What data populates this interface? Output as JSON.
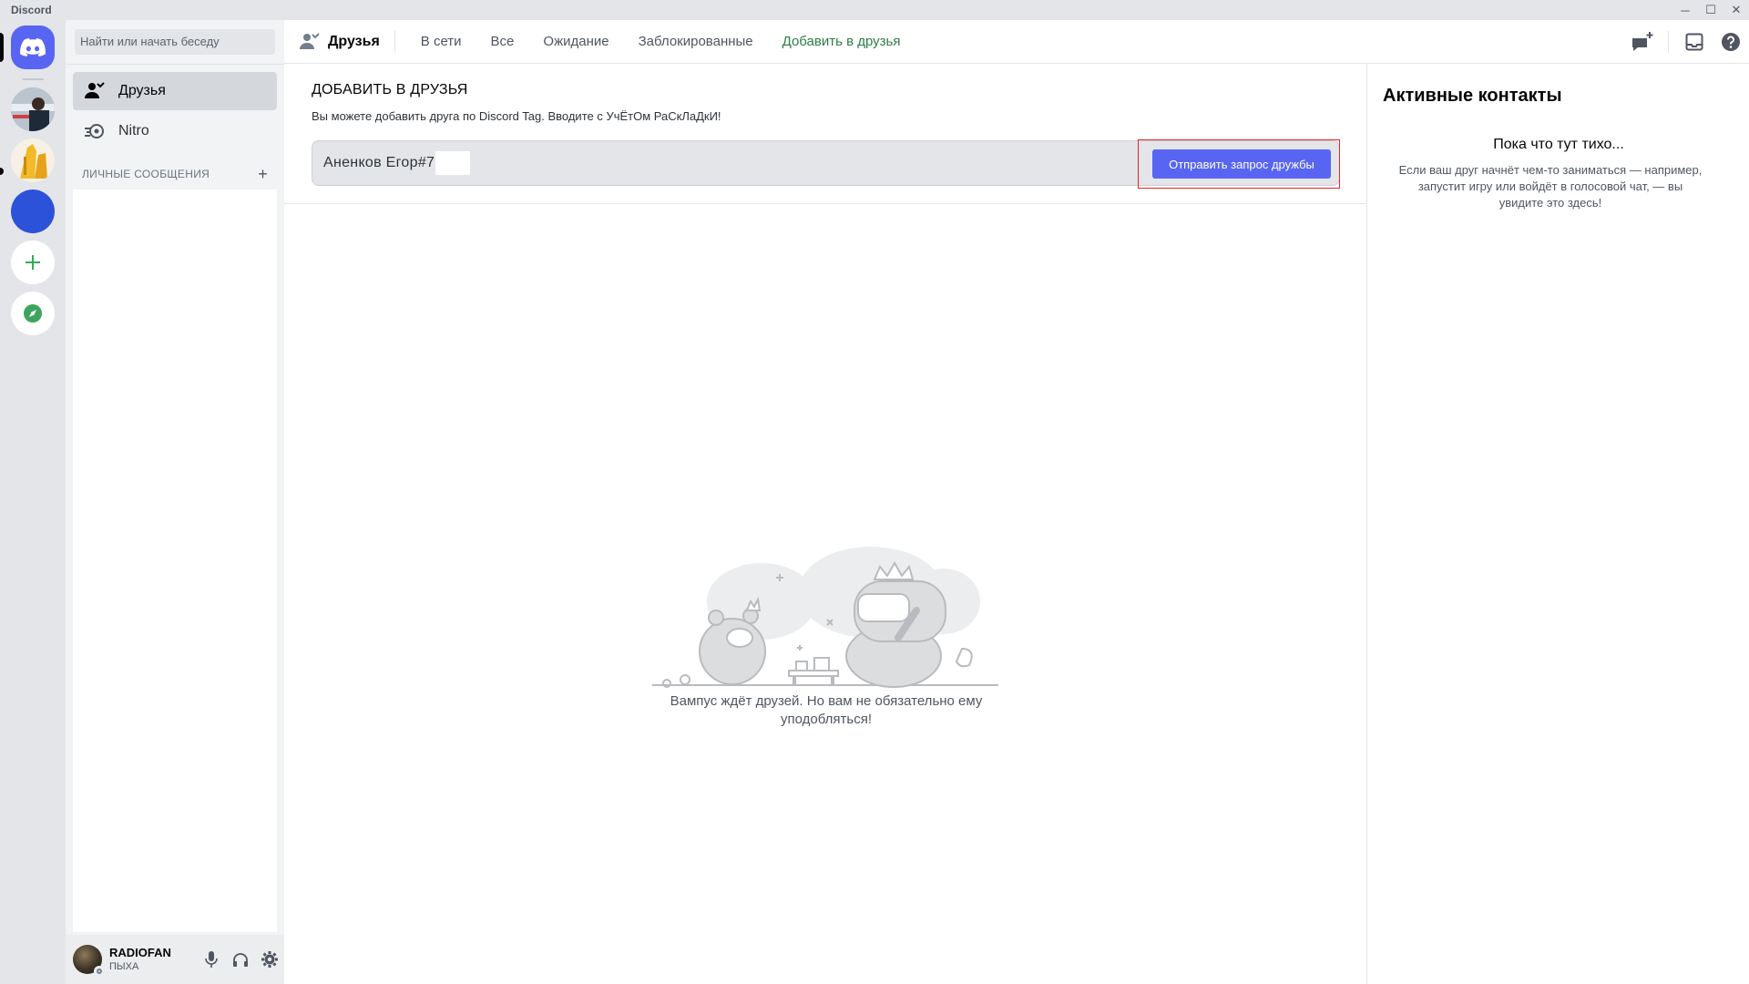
{
  "window": {
    "title": "Discord",
    "controls": {
      "minimize": "─",
      "maximize": "☐",
      "close": "✕"
    }
  },
  "servers": [
    {
      "name": "home",
      "icon": "discord-logo-icon"
    },
    {
      "name": "server-1",
      "icon": "image-avatar"
    },
    {
      "name": "server-2",
      "icon": "image-avatar"
    },
    {
      "name": "server-3",
      "icon": "blue-circle"
    },
    {
      "name": "add-server",
      "icon": "plus-icon"
    },
    {
      "name": "explore",
      "icon": "compass-icon"
    }
  ],
  "sidebar": {
    "search_placeholder": "Найти или начать беседу",
    "items": [
      {
        "label": "Друзья",
        "icon": "friends-icon"
      },
      {
        "label": "Nitro",
        "icon": "nitro-icon"
      }
    ],
    "dm_header": "ЛИЧНЫЕ СООБЩЕНИЯ",
    "dm_add": "+"
  },
  "user_panel": {
    "username": "RADIOFAN",
    "status": "ПЫХА",
    "icons": [
      "microphone-icon",
      "headphones-icon",
      "settings-gear-icon"
    ]
  },
  "topbar": {
    "title": "Друзья",
    "tabs": [
      "В сети",
      "Все",
      "Ожидание",
      "Заблокированные"
    ],
    "add_friend_tab": "Добавить в друзья",
    "icons": [
      "new-group-dm-icon",
      "inbox-icon",
      "help-icon"
    ]
  },
  "add_friend": {
    "title": "ДОБАВИТЬ В ДРУЗЬЯ",
    "description": "Вы можете добавить друга по Discord Tag. Вводите с УчЁтОм РаСкЛаДкИ!",
    "input_value": "Аненков Егор#7",
    "button_label": "Отправить запрос дружбы"
  },
  "empty_state": {
    "text": "Вампус ждёт друзей. Но вам не обязательно ему уподобляться!"
  },
  "active_now": {
    "title": "Активные контакты",
    "quiet_title": "Пока что тут тихо...",
    "quiet_desc": "Если ваш друг начнёт чем-то заниматься — например, запустит игру или войдёт в голосовой чат, — вы увидите это здесь!"
  },
  "colors": {
    "accent": "#5865f2",
    "add_friend_green": "#2d7d46",
    "highlight_red": "#e0252b"
  }
}
